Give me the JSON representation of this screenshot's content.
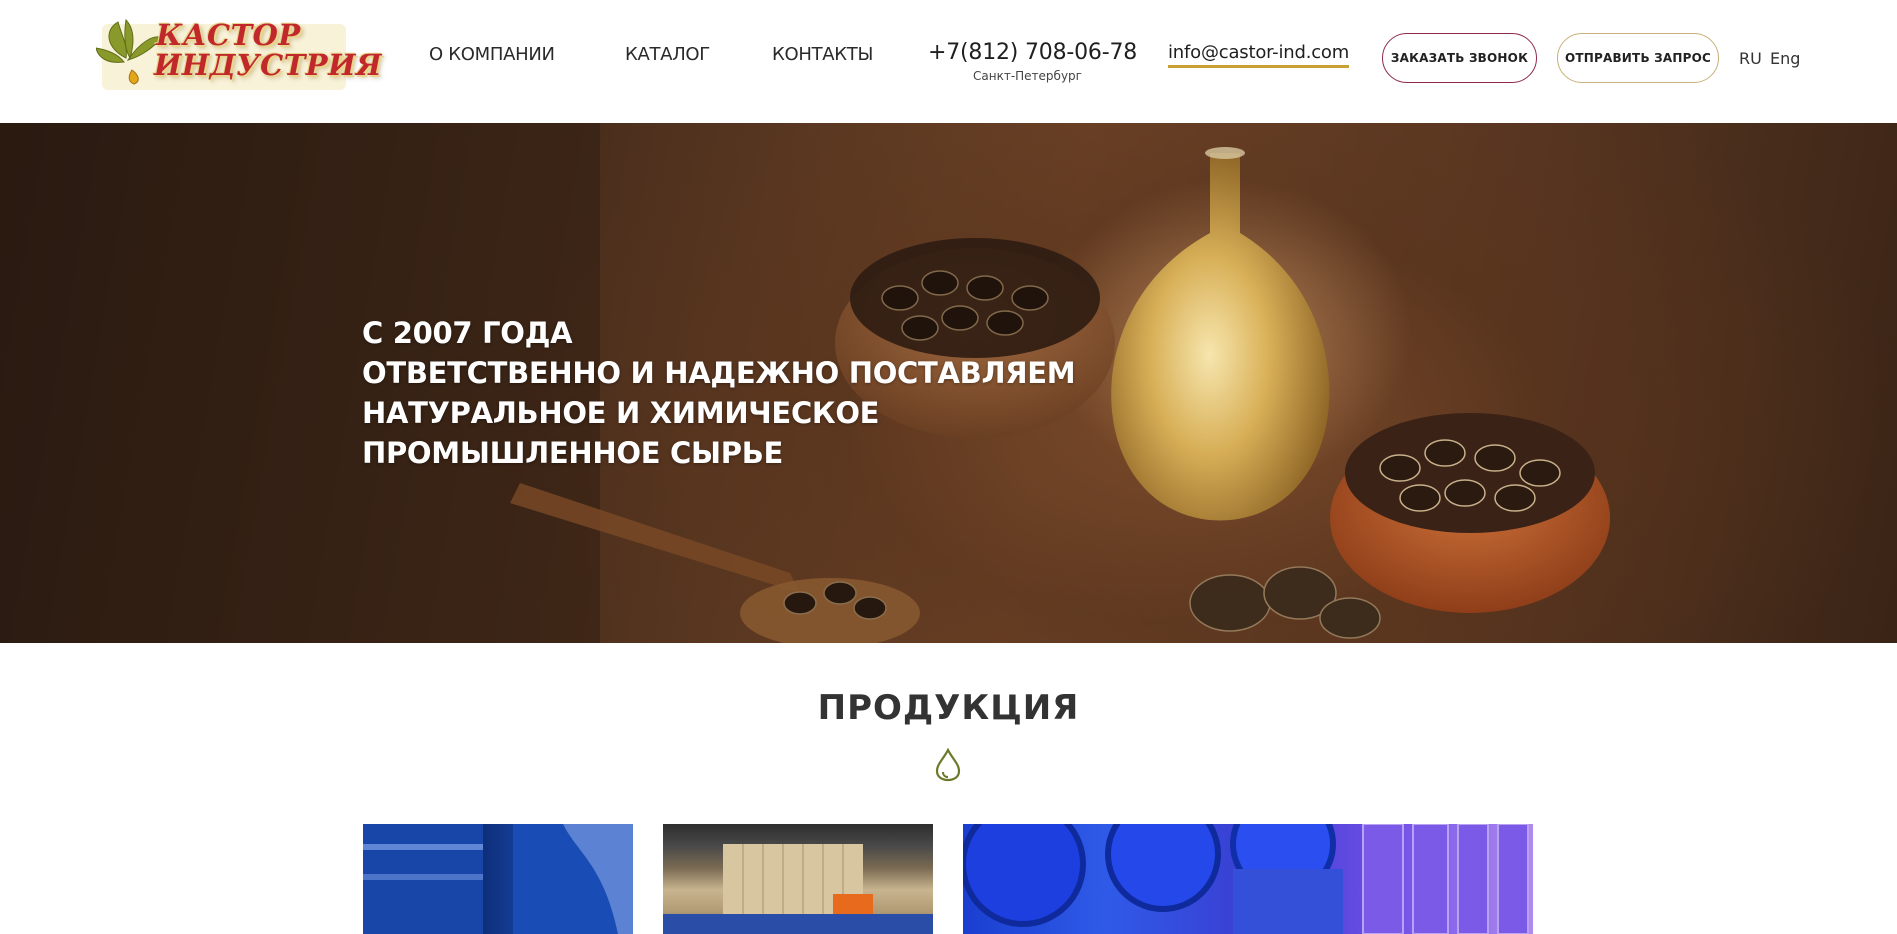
{
  "brand": {
    "line1": "КАСТОР",
    "line2": "ИНДУСТРИЯ"
  },
  "nav": {
    "about": "О КОМПАНИИ",
    "catalog": "КАТАЛОГ",
    "contacts": "КОНТАКТЫ"
  },
  "contact": {
    "phone": "+7(812) 708-06-78",
    "city": "Санкт-Петербург",
    "email": "info@castor-ind.com"
  },
  "buttons": {
    "call": "ЗАКАЗАТЬ ЗВОНОК",
    "request": "ОТПРАВИТЬ ЗАПРОС"
  },
  "languages": {
    "ru": "RU",
    "en": "Eng"
  },
  "hero": {
    "lines": [
      "С 2007 ГОДА",
      "ОТВЕТСТВЕННО И НАДЕЖНО ПОСТАВЛЯЕМ",
      "НАТУРАЛЬНОЕ И ХИМИЧЕСКОЕ",
      "ПРОМЫШЛЕННОЕ СЫРЬЕ"
    ]
  },
  "products": {
    "title": "ПРОДУКЦИЯ"
  },
  "colors": {
    "accent_gold": "#c9a035",
    "accent_maroon": "#8e2a49",
    "drop_green": "#6a7a2a",
    "logo_red": "#c0282c"
  },
  "icons": {
    "logo": "castor-leaf-logo",
    "divider": "oil-drop-icon"
  }
}
